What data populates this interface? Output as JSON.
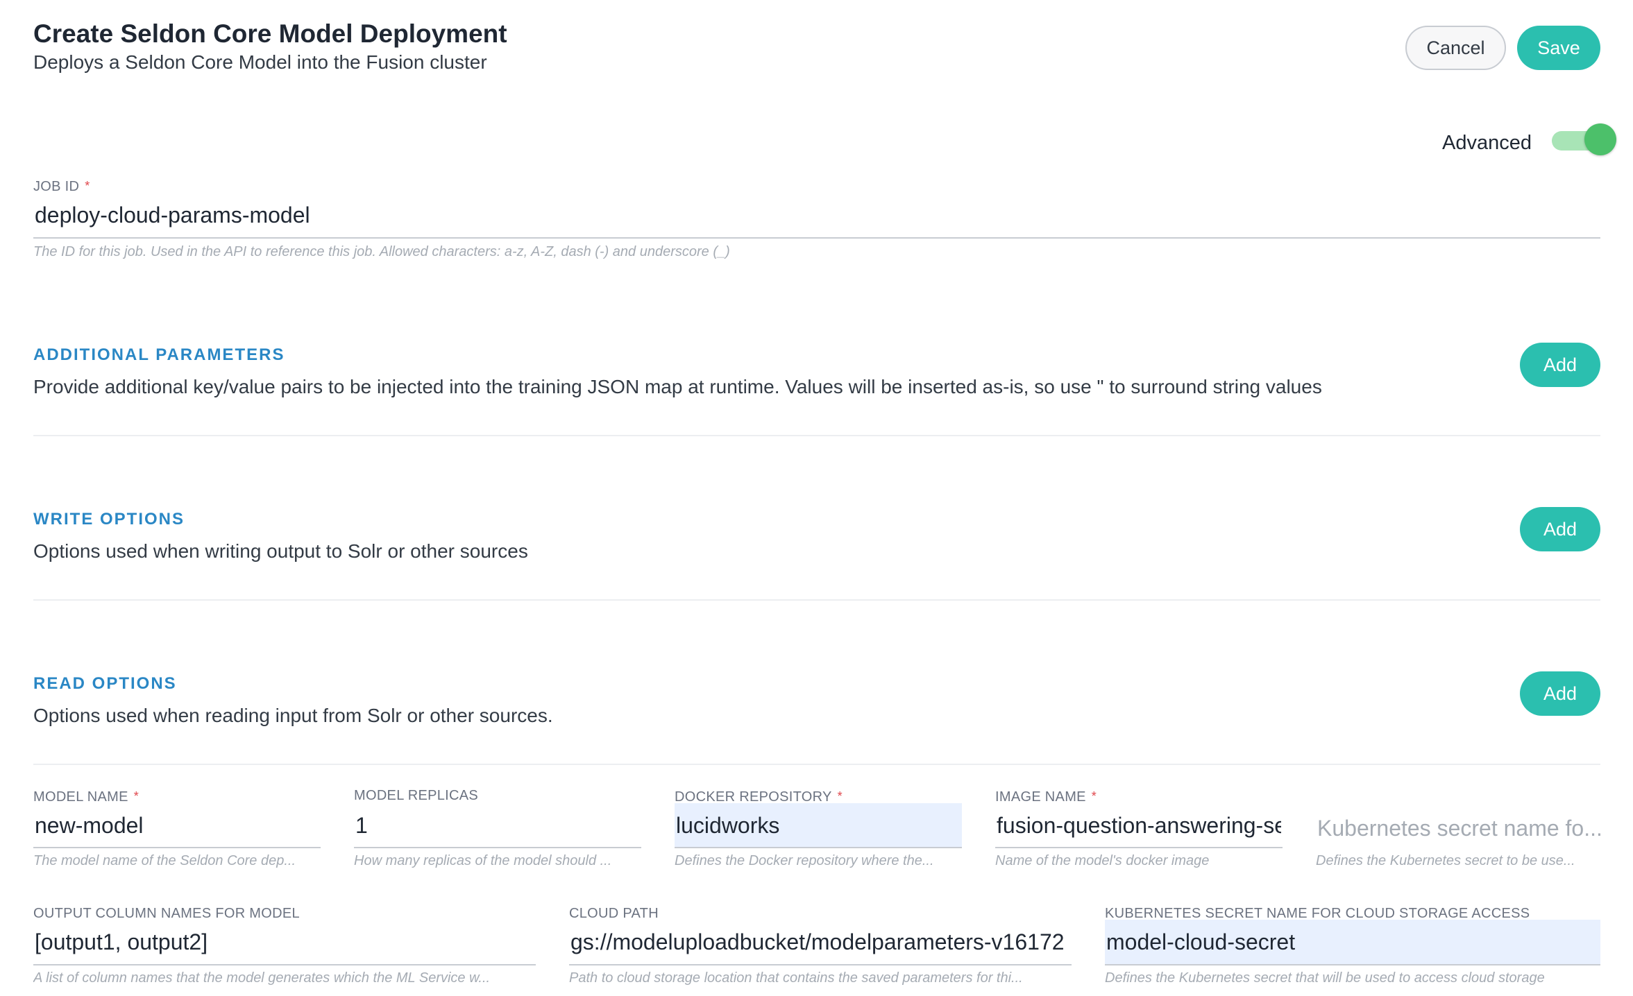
{
  "header": {
    "title": "Create Seldon Core Model Deployment",
    "subtitle": "Deploys a Seldon Core Model into the Fusion cluster",
    "cancel_label": "Cancel",
    "save_label": "Save"
  },
  "advanced": {
    "label": "Advanced",
    "enabled": true
  },
  "job_id": {
    "label": "JOB ID",
    "required_mark": "*",
    "value": "deploy-cloud-params-model",
    "help": "The ID for this job. Used in the API to reference this job. Allowed characters: a-z, A-Z, dash (-) and underscore (_)"
  },
  "sections": [
    {
      "title": "ADDITIONAL PARAMETERS",
      "description": "Provide additional key/value pairs to be injected into the training JSON map at runtime. Values will be inserted as-is, so use \" to surround string values",
      "add_label": "Add"
    },
    {
      "title": "WRITE OPTIONS",
      "description": "Options used when writing output to Solr or other sources",
      "add_label": "Add"
    },
    {
      "title": "READ OPTIONS",
      "description": "Options used when reading input from Solr or other sources.",
      "add_label": "Add"
    }
  ],
  "fields_row1": [
    {
      "label": "MODEL NAME",
      "required_mark": "*",
      "value": "new-model",
      "help": "The model name of the Seldon Core dep..."
    },
    {
      "label": "MODEL REPLICAS",
      "required_mark": "",
      "value": "1",
      "help": "How many replicas of the model should ..."
    },
    {
      "label": "DOCKER REPOSITORY",
      "required_mark": "*",
      "value": "lucidworks",
      "help": "Defines the Docker repository where the..."
    },
    {
      "label": "IMAGE NAME",
      "required_mark": "*",
      "value": "fusion-question-answering-se",
      "help": "Name of the model's docker image"
    },
    {
      "label": "",
      "required_mark": "",
      "placeholder": "Kubernetes secret name fo...",
      "help": "Defines the Kubernetes secret to be use..."
    }
  ],
  "fields_row2": [
    {
      "label": "OUTPUT COLUMN NAMES FOR MODEL",
      "value": "[output1, output2]",
      "help": "A list of column names that the model generates which the ML Service w..."
    },
    {
      "label": "CLOUD PATH",
      "value": "gs://modeluploadbucket/modelparameters-v16172",
      "help": "Path to cloud storage location that contains the saved parameters for thi..."
    },
    {
      "label": "KUBERNETES SECRET NAME FOR CLOUD STORAGE ACCESS",
      "value": "model-cloud-secret",
      "help": "Defines the Kubernetes secret that will be used to access cloud storage"
    }
  ]
}
